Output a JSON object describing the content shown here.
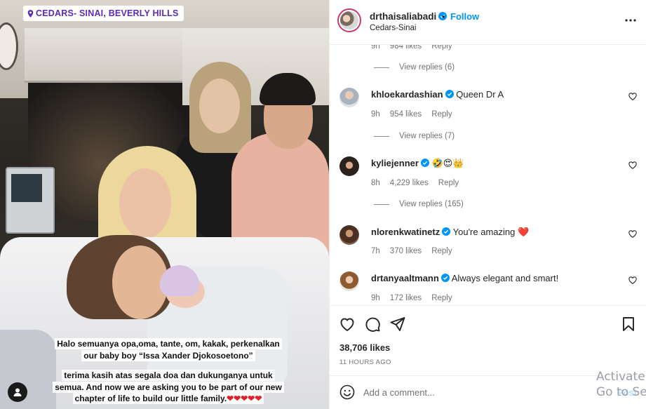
{
  "photo": {
    "location_tag": "CEDARS- SINAI, BEVERLY HILLS",
    "caption_line1": "Halo semuanya opa,oma, tante, om, kakak, perkenalkan",
    "caption_line2": "our baby boy “Issa Xander Djokosoetono”",
    "caption_line3": "terima kasih atas segala doa dan dukunganya untuk",
    "caption_line4": "semua. And now we are asking you to be part of our new",
    "caption_line5": "chapter of life to build our little family.",
    "caption_hearts": "❤❤❤❤❤"
  },
  "header": {
    "username": "drthaisaliabadi",
    "separator": "•",
    "follow_label": "Follow",
    "location": "Cedars-Sinai"
  },
  "comments": {
    "top_partial": {
      "time": "9h",
      "likes": "984 likes",
      "reply": "Reply",
      "view_replies": "View replies (6)"
    },
    "items": [
      {
        "user": "khloekardashian",
        "text": "Queen Dr A",
        "time": "9h",
        "likes": "954 likes",
        "reply": "Reply",
        "view_replies": "View replies (7)"
      },
      {
        "user": "kyliejenner",
        "text": "🤣😍👑",
        "time": "8h",
        "likes": "4,229 likes",
        "reply": "Reply",
        "view_replies": "View replies (165)"
      },
      {
        "user": "nlorenkwatinetz",
        "text": "You're amazing ❤️",
        "time": "7h",
        "likes": "370 likes",
        "reply": "Reply"
      },
      {
        "user": "drtanyaaltmann",
        "text": "Always elegant and smart!",
        "time": "9h",
        "likes": "172 likes",
        "reply": "Reply"
      }
    ]
  },
  "footer": {
    "likes": "38,706 likes",
    "time": "11 HOURS AGO",
    "comment_placeholder": "Add a comment...",
    "post_label": "Post"
  },
  "watermark": {
    "line1": "Activate",
    "line2": "Go to Sett"
  },
  "colors": {
    "link_blue": "#0095f6",
    "verified_blue": "#0095f6",
    "location_purple": "#5b2bb5",
    "heart_red": "#e0202a"
  }
}
